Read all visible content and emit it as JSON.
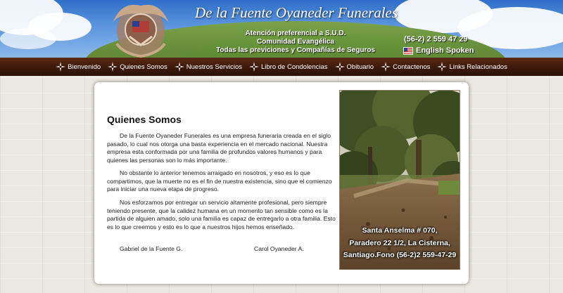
{
  "header": {
    "site_title": "De la Fuente Oyaneder Funerales",
    "taglines": [
      "Atención preferencial a S.U.D.",
      "Comunidad Evangélica",
      "Todas las previciones y Compañías de Seguros"
    ],
    "phone": "(56-2) 2 559 47 29",
    "english_label": "English Spoken"
  },
  "nav": {
    "items": [
      {
        "label": "Bienvenido"
      },
      {
        "label": "Quienes Somos"
      },
      {
        "label": "Nuestros Servicios"
      },
      {
        "label": "Libro de Condolencias"
      },
      {
        "label": "Obituario"
      },
      {
        "label": "Contactenos"
      },
      {
        "label": "Links Relacionados"
      }
    ]
  },
  "main": {
    "heading": "Quienes Somos",
    "paragraphs": [
      "De la Fuente Oyaneder Funerales es una empresa funeraria creada en el siglo pasado, lo cual nos otorga una basta experiencia en el mercado nacional. Nuestra empresa esta conformada por una familia de profundos valores humanos y para quienes las personas son lo más importante.",
      "No obstante lo anterior tenemos arraigado en nosotros, y eso es lo que compartimos, que la muerte no es el fin de nuestra existencia, sino que el comienzo para iniciar una nueva etapa de progreso.",
      "Nos esforzamos por entregar un servicio altamente profesional, pero siempre teniendo presente, que la calidez humana en un momento tan sensible como es la partida de alguien amado, solo una familia es capaz de entregarlo a otra familia. Esto es lo que creemos y esto es lo que a nuestros hijos hemos enseñado."
    ],
    "signatures": [
      "Gabriel de la Fuente G.",
      "Carol Oyaneder A."
    ]
  },
  "photo": {
    "address_lines": [
      "Santa Anselma # 070,",
      "Paradero 22 1/2, La Cisterna,",
      "Santiago.Fono (56-2)2 559-47-29"
    ]
  },
  "colors": {
    "nav_bg": "#3a180a",
    "panel_bg": "#ffffff",
    "sky": "#5b95de"
  },
  "icons": {
    "nav_separator": "cross-icon",
    "emblem": "emblem-icon",
    "flag": "us-flag-icon"
  }
}
